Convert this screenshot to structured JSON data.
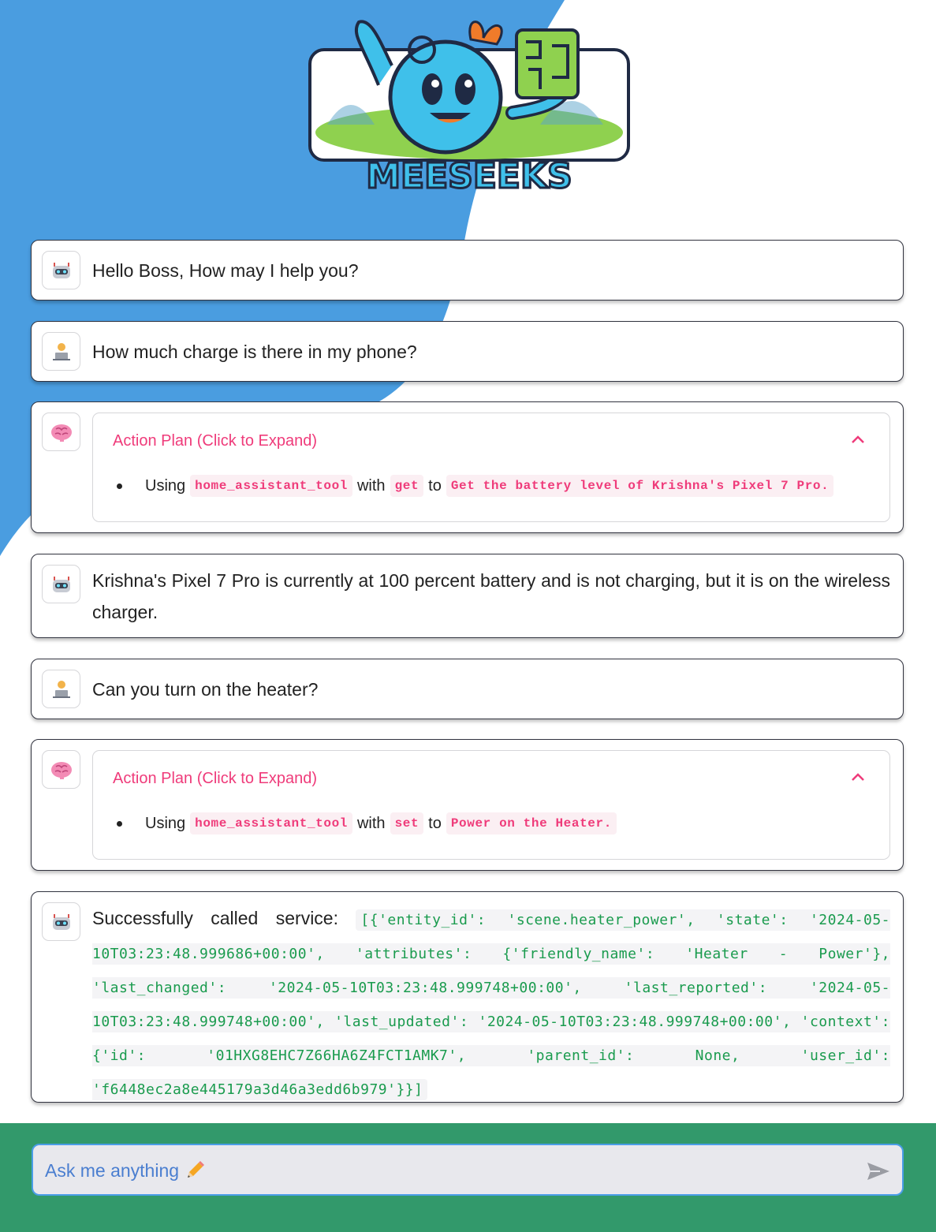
{
  "app": {
    "logo_text": "MEESEEKS"
  },
  "messages": [
    {
      "role": "assistant",
      "icon": "robot-icon",
      "text": "Hello Boss, How may I help you?"
    },
    {
      "role": "user",
      "icon": "user-laptop-icon",
      "text": "How much charge is there in my phone?"
    },
    {
      "role": "plan",
      "icon": "brain-icon",
      "title": "Action Plan (Click to Expand)",
      "step": {
        "using": "Using",
        "tool": "home_assistant_tool",
        "with": "with",
        "action": "get",
        "to": "to",
        "task": "Get the battery level of Krishna's Pixel 7 Pro."
      }
    },
    {
      "role": "assistant",
      "icon": "robot-icon",
      "text": "Krishna's Pixel 7 Pro is currently at 100 percent battery and is not charging, but it is on the wireless charger."
    },
    {
      "role": "user",
      "icon": "user-laptop-icon",
      "text": "Can you turn on the heater?"
    },
    {
      "role": "plan",
      "icon": "brain-icon",
      "title": "Action Plan (Click to Expand)",
      "step": {
        "using": "Using",
        "tool": "home_assistant_tool",
        "with": "with",
        "action": "set",
        "to": "to",
        "task": "Power on the Heater."
      }
    },
    {
      "role": "assistant",
      "icon": "robot-icon",
      "text": "Successfully called service:",
      "code": "[{'entity_id': 'scene.heater_power', 'state': '2024-05-10T03:23:48.999686+00:00', 'attributes': {'friendly_name': 'Heater - Power'}, 'last_changed': '2024-05-10T03:23:48.999748+00:00', 'last_reported': '2024-05-10T03:23:48.999748+00:00', 'last_updated': '2024-05-10T03:23:48.999748+00:00', 'context': {'id': '01HXG8EHC7Z66HA6Z4FCT1AMK7', 'parent_id': None, 'user_id': 'f6448ec2a8e445179a3d46a3edd6b979'}}]"
    }
  ],
  "chat_input": {
    "placeholder": "Ask me anything",
    "icon": "pencil-icon",
    "send_icon": "send-icon"
  },
  "colors": {
    "accent_pink": "#ef3b7a",
    "code_green": "#1a9b4e",
    "footer_green": "#32996b",
    "bg_blue": "#4a9de0",
    "input_border": "#4a9de8"
  }
}
